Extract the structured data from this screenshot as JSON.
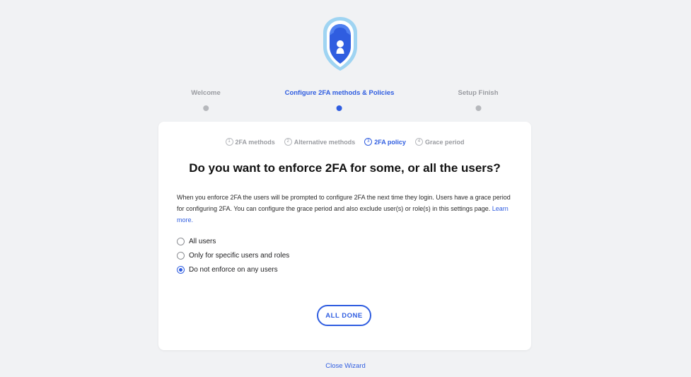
{
  "colors": {
    "accent": "#2f5de0",
    "muted": "#9a9ca1",
    "background": "#f1f2f4",
    "card": "#ffffff"
  },
  "logo": {
    "icon": "shield-lock-icon"
  },
  "wizard_steps": [
    {
      "label": "Welcome",
      "state": "inactive"
    },
    {
      "label": "Configure 2FA methods & Policies",
      "state": "active"
    },
    {
      "label": "Setup Finish",
      "state": "inactive"
    }
  ],
  "sub_steps": [
    {
      "number": "1",
      "label": "2FA methods",
      "state": "inactive"
    },
    {
      "number": "2",
      "label": "Alternative methods",
      "state": "inactive"
    },
    {
      "number": "3",
      "label": "2FA policy",
      "state": "active"
    },
    {
      "number": "4",
      "label": "Grace period",
      "state": "inactive"
    }
  ],
  "card": {
    "heading": "Do you want to enforce 2FA for some, or all the users?",
    "description": "When you enforce 2FA the users will be prompted to configure 2FA the next time they login. Users have a grace period for configuring 2FA. You can configure the grace period and also exclude user(s) or role(s) in this settings page. ",
    "learn_more": "Learn more.",
    "options": [
      {
        "label": "All users",
        "checked": false
      },
      {
        "label": "Only for specific users and roles",
        "checked": false
      },
      {
        "label": "Do not enforce on any users",
        "checked": true
      }
    ],
    "done_label": "ALL DONE"
  },
  "close_label": "Close Wizard"
}
